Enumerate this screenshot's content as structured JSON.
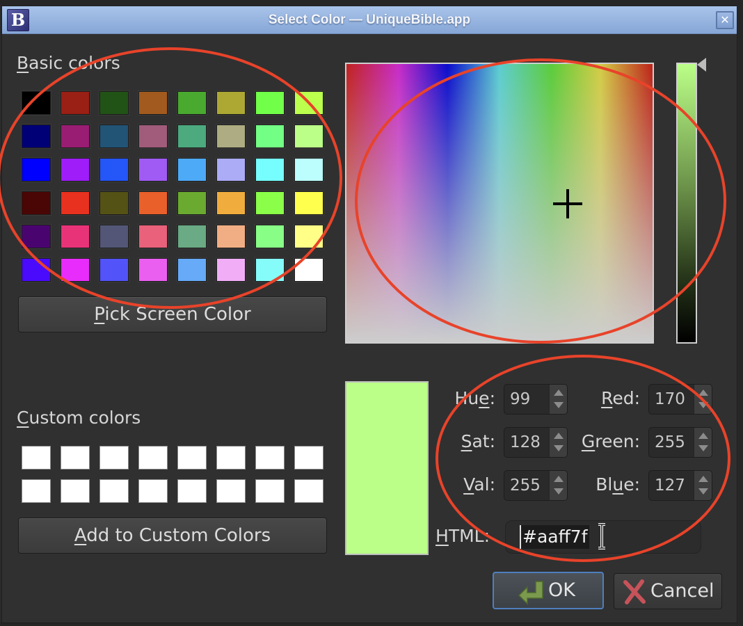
{
  "window": {
    "title": "Select Color — UniqueBible.app",
    "app_icon_letter": "B"
  },
  "basic_colors": {
    "label_prefix_underlined": "B",
    "label_rest": "asic colors",
    "swatches": [
      [
        "#000000",
        "#9a1f14",
        "#225316",
        "#a35a1e",
        "#49aa2f",
        "#aca833",
        "#72ff49",
        "#bcff4d"
      ],
      [
        "#000076",
        "#991d73",
        "#225476",
        "#a05c7a",
        "#4caa7e",
        "#adac82",
        "#73ff85",
        "#bcff88"
      ],
      [
        "#0000ff",
        "#9e1df8",
        "#2556f8",
        "#a05bf4",
        "#4daaf7",
        "#ababf6",
        "#76fdfd",
        "#bcfdfd"
      ],
      [
        "#4a0604",
        "#e8311f",
        "#555216",
        "#e9602a",
        "#6aaa30",
        "#f0ad3e",
        "#8afe48",
        "#ffff4d"
      ],
      [
        "#4a0470",
        "#e83378",
        "#535676",
        "#e9617a",
        "#6aaa84",
        "#f1ae84",
        "#88fe87",
        "#ffff88"
      ],
      [
        "#4a0afc",
        "#e82cfb",
        "#5253f8",
        "#ea5ff0",
        "#66aaf8",
        "#f1aef7",
        "#86fcfa",
        "#ffffff"
      ]
    ]
  },
  "pick_screen_color": {
    "underlined": "P",
    "rest": "ick Screen Color"
  },
  "custom_colors": {
    "label_prefix_underlined": "C",
    "label_rest": "ustom colors",
    "swatches": [
      [
        "#ffffff",
        "#ffffff",
        "#ffffff",
        "#ffffff",
        "#ffffff",
        "#ffffff",
        "#ffffff",
        "#ffffff"
      ],
      [
        "#ffffff",
        "#ffffff",
        "#ffffff",
        "#ffffff",
        "#ffffff",
        "#ffffff",
        "#ffffff",
        "#ffffff"
      ]
    ]
  },
  "add_to_custom": {
    "underlined": "A",
    "rest": "dd to Custom Colors"
  },
  "current_color": "#bbff88",
  "fields": {
    "hue": {
      "pre": "Hu",
      "underlined": "e",
      "post": ":",
      "value": "99"
    },
    "sat": {
      "pre": "",
      "underlined": "S",
      "post": "at:",
      "value": "128"
    },
    "val": {
      "pre": "",
      "underlined": "V",
      "post": "al:",
      "value": "255"
    },
    "red": {
      "pre": "",
      "underlined": "R",
      "post": "ed:",
      "value": "170"
    },
    "green": {
      "pre": "",
      "underlined": "G",
      "post": "reen:",
      "value": "255"
    },
    "blue": {
      "pre": "Bl",
      "underlined": "u",
      "post": "e:",
      "value": "127"
    },
    "html": {
      "pre": "",
      "underlined": "H",
      "post": "TML:",
      "value": "#aaff7f"
    }
  },
  "buttons": {
    "ok": "OK",
    "cancel": "Cancel"
  },
  "annotation_color": "#e8432a"
}
